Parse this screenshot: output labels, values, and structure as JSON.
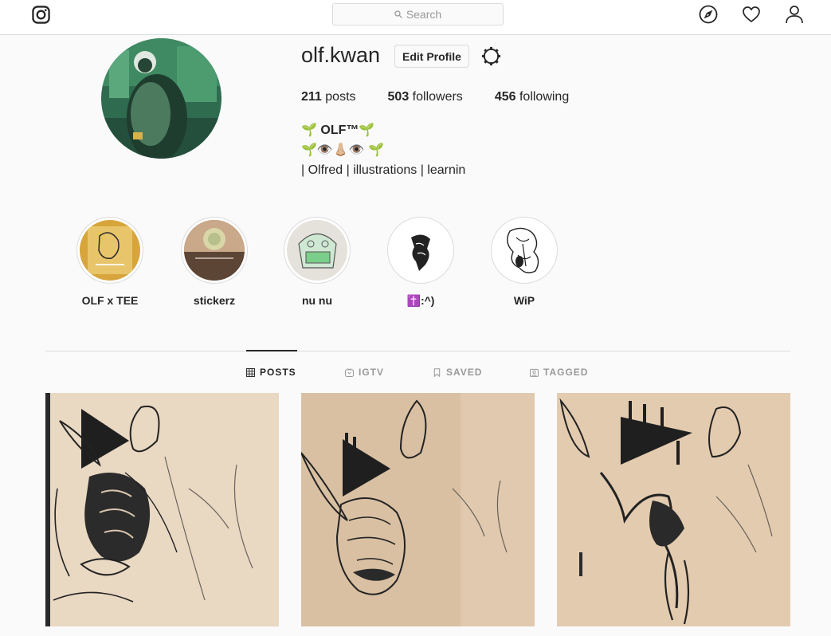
{
  "search": {
    "placeholder": "Search"
  },
  "profile": {
    "username": "olf.kwan",
    "edit_label": "Edit Profile",
    "stats": {
      "posts_count": "211",
      "posts_label": "posts",
      "followers_count": "503",
      "followers_label": "followers",
      "following_count": "456",
      "following_label": "following"
    },
    "bio": {
      "name": "🌱 OLF™🌱",
      "line2": "🌱👁️👃🏼👁️ 🌱",
      "line3": "| Olfred | illustrations | learnin"
    }
  },
  "highlights": [
    {
      "label": "OLF x TEE"
    },
    {
      "label": "stickerz"
    },
    {
      "label": "nu nu"
    },
    {
      "label": "✝️:^)"
    },
    {
      "label": "WiP"
    }
  ],
  "tabs": [
    {
      "label": "POSTS",
      "icon": "grid-icon",
      "active": true
    },
    {
      "label": "IGTV",
      "icon": "igtv-icon",
      "active": false
    },
    {
      "label": "SAVED",
      "icon": "bookmark-icon",
      "active": false
    },
    {
      "label": "TAGGED",
      "icon": "tagged-icon",
      "active": false
    }
  ],
  "nav_icons": [
    "compass-icon",
    "heart-icon",
    "user-icon"
  ],
  "colors": {
    "border": "#dbdbdb",
    "text": "#262626",
    "muted": "#999999",
    "background": "#fafafa"
  }
}
